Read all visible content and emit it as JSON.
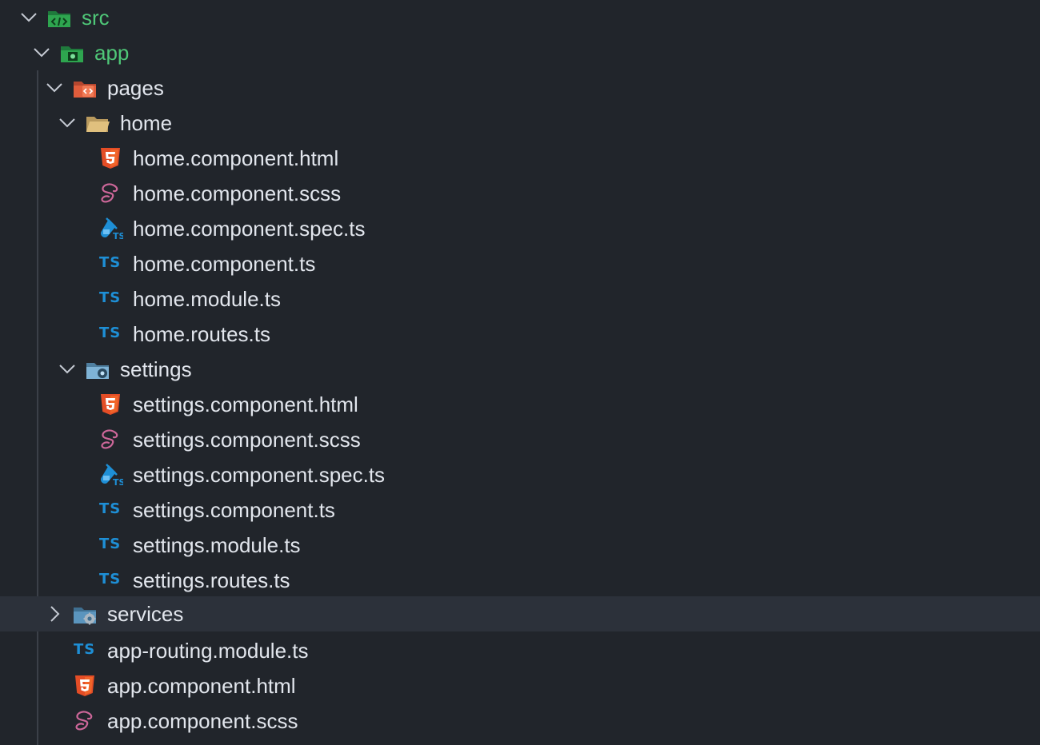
{
  "explorer": {
    "src": {
      "label": "src",
      "icon": "folder-src-icon",
      "expanded": true
    },
    "app": {
      "label": "app",
      "icon": "folder-app-icon",
      "expanded": true
    },
    "pages": {
      "label": "pages",
      "icon": "folder-views-icon",
      "expanded": true
    },
    "home": {
      "label": "home",
      "icon": "folder-open-icon",
      "expanded": true,
      "files": [
        {
          "label": "home.component.html",
          "icon": "html5-icon",
          "ts": ""
        },
        {
          "label": "home.component.scss",
          "icon": "sass-icon",
          "ts": ""
        },
        {
          "label": "home.component.spec.ts",
          "icon": "test-ts-icon",
          "ts": ""
        },
        {
          "label": "home.component.ts",
          "icon": "typescript-icon",
          "ts": "TS"
        },
        {
          "label": "home.module.ts",
          "icon": "typescript-icon",
          "ts": "TS"
        },
        {
          "label": "home.routes.ts",
          "icon": "typescript-icon",
          "ts": "TS"
        }
      ]
    },
    "settings": {
      "label": "settings",
      "icon": "folder-settings-icon",
      "expanded": true,
      "files": [
        {
          "label": "settings.component.html",
          "icon": "html5-icon",
          "ts": ""
        },
        {
          "label": "settings.component.scss",
          "icon": "sass-icon",
          "ts": ""
        },
        {
          "label": "settings.component.spec.ts",
          "icon": "test-ts-icon",
          "ts": ""
        },
        {
          "label": "settings.component.ts",
          "icon": "typescript-icon",
          "ts": "TS"
        },
        {
          "label": "settings.module.ts",
          "icon": "typescript-icon",
          "ts": "TS"
        },
        {
          "label": "settings.routes.ts",
          "icon": "typescript-icon",
          "ts": "TS"
        }
      ]
    },
    "services": {
      "label": "services",
      "icon": "folder-services-icon",
      "expanded": false,
      "selected": true
    },
    "app_files": [
      {
        "label": "app-routing.module.ts",
        "icon": "typescript-icon",
        "ts": "TS"
      },
      {
        "label": "app.component.html",
        "icon": "html5-icon",
        "ts": ""
      },
      {
        "label": "app.component.scss",
        "icon": "sass-icon",
        "ts": ""
      }
    ]
  },
  "colors": {
    "background": "#21252b",
    "selected_row": "#2c313a",
    "text": "#e2e6ed",
    "src_folder_text": "#4fc878",
    "typescript": "#1e8fd6",
    "html5": "#e44d26",
    "sass": "#cd6799"
  }
}
